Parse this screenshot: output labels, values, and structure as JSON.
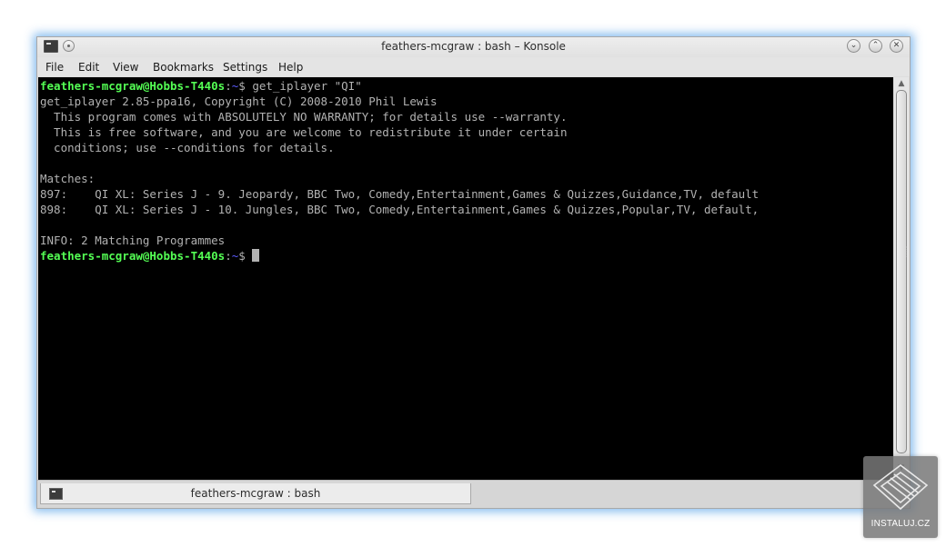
{
  "window": {
    "title": "feathers-mcgraw : bash – Konsole",
    "buttons": {
      "minimize": "⌄",
      "maximize": "⌃",
      "close": "✕"
    }
  },
  "menubar": {
    "items": [
      "File",
      "Edit",
      "View",
      "Bookmarks",
      "Settings",
      "Help"
    ]
  },
  "terminal": {
    "prompt": {
      "user_host": "feathers-mcgraw@Hobbs-T440s",
      "separator": ":",
      "path": "~",
      "symbol": "$ "
    },
    "command": "get_iplayer \"QI\"",
    "output": [
      "get_iplayer 2.85-ppa16, Copyright (C) 2008-2010 Phil Lewis",
      "  This program comes with ABSOLUTELY NO WARRANTY; for details use --warranty.",
      "  This is free software, and you are welcome to redistribute it under certain",
      "  conditions; use --conditions for details.",
      "",
      "Matches:",
      "897:    QI XL: Series J - 9. Jeopardy, BBC Two, Comedy,Entertainment,Games & Quizzes,Guidance,TV, default",
      "898:    QI XL: Series J - 10. Jungles, BBC Two, Comedy,Entertainment,Games & Quizzes,Popular,TV, default,",
      "",
      "INFO: 2 Matching Programmes"
    ],
    "colors": {
      "background": "#000000",
      "text": "#b2b2b2",
      "prompt_user": "#54ff54",
      "prompt_path": "#5c5cff"
    }
  },
  "tabs": [
    {
      "label": "feathers-mcgraw : bash",
      "icon": "terminal-icon"
    }
  ],
  "watermark": {
    "text": "INSTALUJ.CZ"
  }
}
